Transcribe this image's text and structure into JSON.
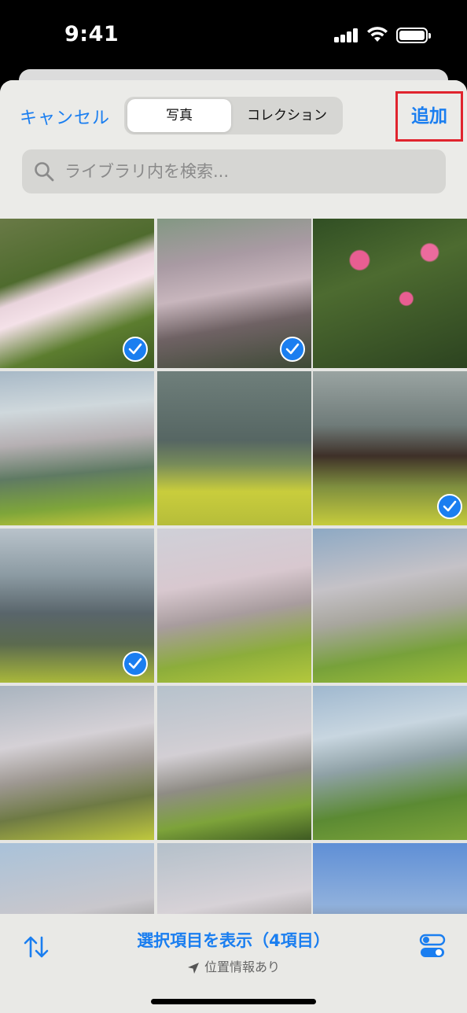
{
  "status_bar": {
    "time": "9:41"
  },
  "header": {
    "cancel_label": "キャンセル",
    "segments": [
      "写真",
      "コレクション"
    ],
    "active_segment": "写真",
    "add_label": "追加",
    "add_highlight_color": "#e0242e"
  },
  "search": {
    "placeholder": "ライブラリ内を検索..."
  },
  "photos": [
    {
      "id": 1,
      "subject": "pink cherry blossom closeup",
      "selected": true
    },
    {
      "id": 2,
      "subject": "cherry tree with building",
      "selected": true
    },
    {
      "id": 3,
      "subject": "pink camellia bush",
      "selected": false
    },
    {
      "id": 4,
      "subject": "cherry trees by moat",
      "selected": false
    },
    {
      "id": 5,
      "subject": "water with rapeseed flowers",
      "selected": false
    },
    {
      "id": 6,
      "subject": "tree trunk over water",
      "selected": true
    },
    {
      "id": 7,
      "subject": "moat with bare trees",
      "selected": true
    },
    {
      "id": 8,
      "subject": "blossoming trees on slope",
      "selected": false
    },
    {
      "id": 9,
      "subject": "cherry trees along bank",
      "selected": false
    },
    {
      "id": 10,
      "subject": "large cherry tree",
      "selected": false
    },
    {
      "id": 11,
      "subject": "cherry tree with yellow flowers",
      "selected": false
    },
    {
      "id": 12,
      "subject": "moat view with bridge",
      "selected": false
    },
    {
      "id": 13,
      "subject": "trees along moat",
      "selected": false
    },
    {
      "id": 14,
      "subject": "cherry blossom branches",
      "selected": false
    },
    {
      "id": 15,
      "subject": "city buildings",
      "selected": false
    }
  ],
  "bottom_bar": {
    "show_selected_label": "選択項目を表示（4項目）",
    "location_label": "位置情報あり"
  },
  "colors": {
    "accent": "#1a7ef0",
    "sheet_background": "#e6e6e3"
  }
}
